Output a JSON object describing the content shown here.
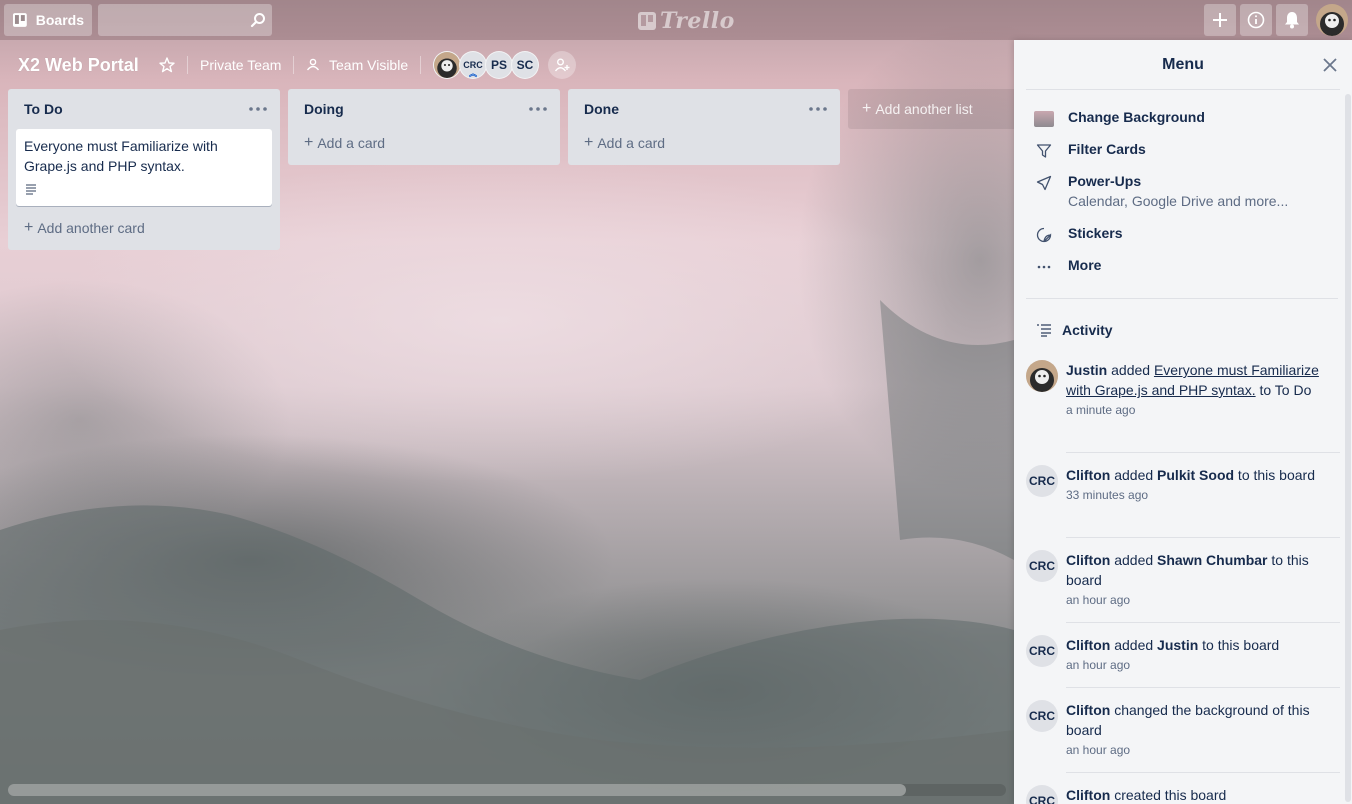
{
  "header": {
    "boards_label": "Boards",
    "search_placeholder": "",
    "logo_text": "Trello"
  },
  "board": {
    "title": "X2 Web Portal",
    "team_label": "Private Team",
    "visibility_label": "Team Visible",
    "members": [
      "CRC",
      "PS",
      "SC"
    ]
  },
  "lists": [
    {
      "title": "To Do",
      "cards": [
        "Everyone must Familiarize with Grape.js and PHP syntax."
      ],
      "add_label": "Add another card"
    },
    {
      "title": "Doing",
      "add_label": "Add a card"
    },
    {
      "title": "Done",
      "add_label": "Add a card"
    }
  ],
  "add_list_label": "Add another list",
  "menu": {
    "title": "Menu",
    "items": [
      {
        "label": "Change Background",
        "icon": "background-thumbnail"
      },
      {
        "label": "Filter Cards",
        "icon": "filter-icon"
      },
      {
        "label": "Power-Ups",
        "sub": "Calendar, Google Drive and more...",
        "icon": "rocket-icon"
      },
      {
        "label": "Stickers",
        "icon": "sticker-icon"
      },
      {
        "label": "More",
        "icon": "ellipsis-icon"
      }
    ],
    "activity_label": "Activity",
    "activity": [
      {
        "user": "Justin",
        "verb": " added ",
        "link": "Everyone must Familiarize with Grape.js and PHP syntax.",
        "rest": " to To Do",
        "time": "a minute ago"
      },
      {
        "user": "Clifton",
        "avatar": "CRC",
        "verb": " added ",
        "target": "Pulkit Sood",
        "rest": " to this board",
        "time": "33 minutes ago"
      },
      {
        "user": "Clifton",
        "avatar": "CRC",
        "verb": " added ",
        "target": "Shawn Chumbar",
        "rest": " to this board",
        "time": "an hour ago"
      },
      {
        "user": "Clifton",
        "avatar": "CRC",
        "verb": " added ",
        "target": "Justin",
        "rest": " to this board",
        "time": "an hour ago"
      },
      {
        "user": "Clifton",
        "avatar": "CRC",
        "verb": " changed the background of this board",
        "time": "an hour ago"
      },
      {
        "user": "Clifton",
        "avatar": "CRC",
        "verb": " created this board"
      }
    ]
  }
}
